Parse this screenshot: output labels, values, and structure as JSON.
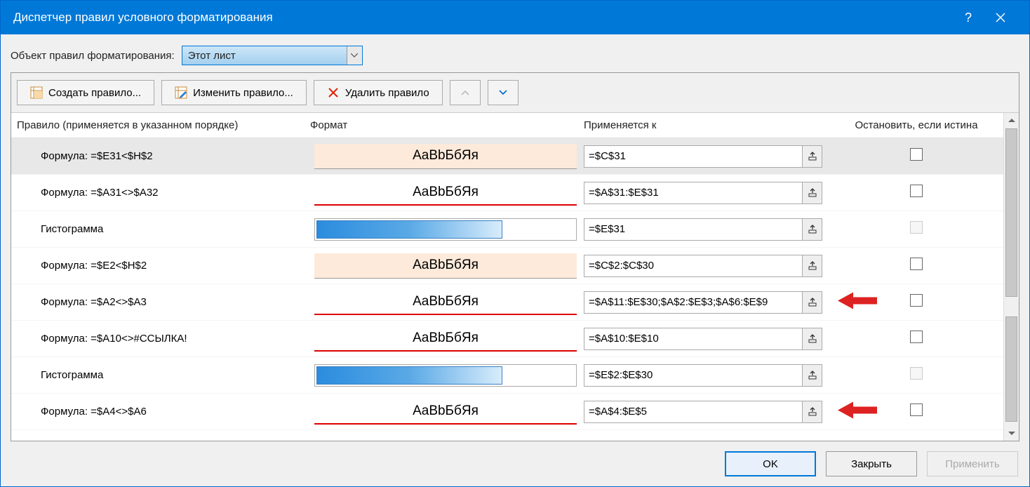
{
  "titlebar": {
    "title": "Диспетчер правил условного форматирования"
  },
  "scope": {
    "label": "Объект правил форматирования:",
    "value": "Этот лист"
  },
  "toolbar": {
    "new": "Создать правило...",
    "edit": "Изменить правило...",
    "delete": "Удалить правило"
  },
  "headers": {
    "rule": "Правило (применяется в указанном порядке)",
    "format": "Формат",
    "applies": "Применяется к",
    "stop": "Остановить, если истина"
  },
  "preview_text": "AaBbБбЯя",
  "rules": [
    {
      "rule": "Формула: =$E31<$H$2",
      "fmt": "yellow",
      "applies": "=$C$31",
      "stop_disabled": false,
      "selected": true,
      "arrow": false
    },
    {
      "rule": "Формула: =$A31<>$A32",
      "fmt": "redline",
      "applies": "=$A$31:$E$31",
      "stop_disabled": false,
      "selected": false,
      "arrow": false
    },
    {
      "rule": "Гистограмма",
      "fmt": "bar",
      "applies": "=$E$31",
      "stop_disabled": true,
      "selected": false,
      "arrow": false
    },
    {
      "rule": "Формула: =$E2<$H$2",
      "fmt": "yellow",
      "applies": "=$C$2:$C$30",
      "stop_disabled": false,
      "selected": false,
      "arrow": false
    },
    {
      "rule": "Формула: =$A2<>$A3",
      "fmt": "redline",
      "applies": "=$A$11:$E$30;$A$2:$E$3;$A$6:$E$9",
      "stop_disabled": false,
      "selected": false,
      "arrow": true
    },
    {
      "rule": "Формула: =$A10<>#ССЫЛКА!",
      "fmt": "redline",
      "applies": "=$A$10:$E$10",
      "stop_disabled": false,
      "selected": false,
      "arrow": false
    },
    {
      "rule": "Гистограмма",
      "fmt": "bar",
      "applies": "=$E$2:$E$30",
      "stop_disabled": true,
      "selected": false,
      "arrow": false
    },
    {
      "rule": "Формула: =$A4<>$A6",
      "fmt": "redline",
      "applies": "=$A$4:$E$5",
      "stop_disabled": false,
      "selected": false,
      "arrow": true
    }
  ],
  "buttons": {
    "ok": "OK",
    "close": "Закрыть",
    "apply": "Применить"
  }
}
